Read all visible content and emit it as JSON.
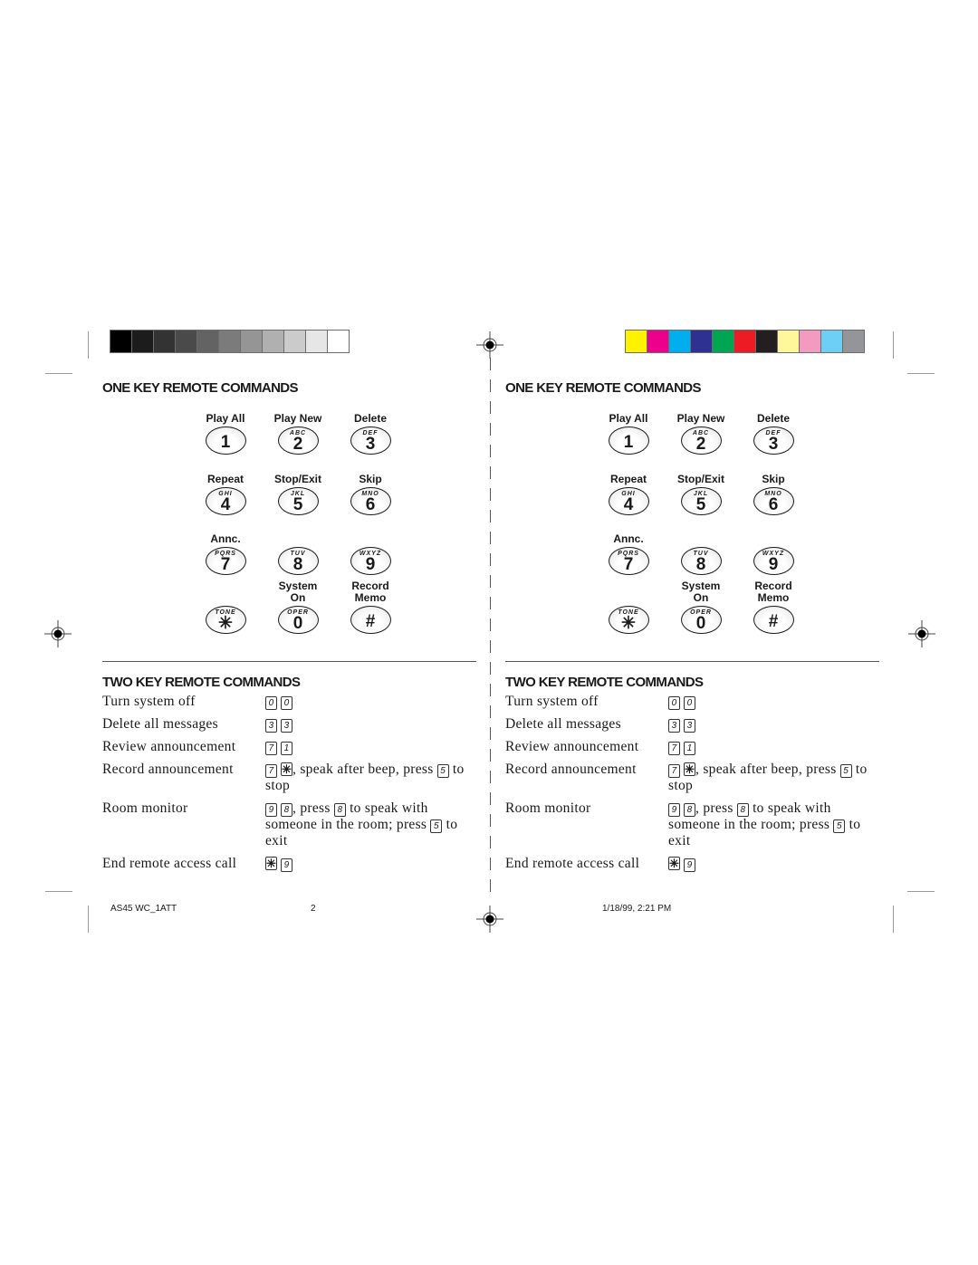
{
  "swatches": {
    "grayscale": [
      "#000000",
      "#1c1c1c",
      "#333333",
      "#4a4a4a",
      "#636363",
      "#7b7b7b",
      "#959595",
      "#b0b0b0",
      "#cbcbcb",
      "#e6e6e6",
      "#ffffff"
    ],
    "color": [
      "#fff200",
      "#ec008c",
      "#00aeef",
      "#2e3192",
      "#00a651",
      "#ed1c24",
      "#231f20",
      "#fff799",
      "#f49ac1",
      "#6dcff6",
      "#939598"
    ]
  },
  "panels": [
    {
      "one_key": {
        "title": "ONE KEY REMOTE COMMANDS",
        "keys": [
          {
            "label": "Play All",
            "letters": "",
            "digit": "1"
          },
          {
            "label": "Play New",
            "letters": "ABC",
            "digit": "2"
          },
          {
            "label": "Delete",
            "letters": "DEF",
            "digit": "3"
          },
          {
            "label": "Repeat",
            "letters": "GHI",
            "digit": "4"
          },
          {
            "label": "Stop/Exit",
            "letters": "JKL",
            "digit": "5"
          },
          {
            "label": "Skip",
            "letters": "MNO",
            "digit": "6"
          },
          {
            "label": "Annc.",
            "letters": "PQRS",
            "digit": "7"
          },
          {
            "label": "",
            "letters": "TUV",
            "digit": "8"
          },
          {
            "label": "",
            "letters": "WXYZ",
            "digit": "9"
          },
          {
            "label": "",
            "letters": "TONE",
            "digit": "✳"
          },
          {
            "label": "System On",
            "letters": "OPER",
            "digit": "0"
          },
          {
            "label": "Record Memo",
            "letters": "",
            "digit": "#"
          }
        ]
      },
      "two_key": {
        "title": "TWO KEY REMOTE COMMANDS",
        "commands": [
          {
            "name": "Turn system off",
            "parts": [
              {
                "k": "0"
              },
              {
                "k": "0"
              }
            ]
          },
          {
            "name": "Delete all messages",
            "parts": [
              {
                "k": "3"
              },
              {
                "k": "3"
              }
            ]
          },
          {
            "name": "Review announcement",
            "parts": [
              {
                "k": "7"
              },
              {
                "k": "1"
              }
            ]
          },
          {
            "name": "Record announcement",
            "parts": [
              {
                "k": "7"
              },
              {
                "k": "✳"
              },
              {
                "t": ", speak after beep, press "
              },
              {
                "k": "5"
              },
              {
                "t": " to stop"
              }
            ]
          },
          {
            "name": "Room monitor",
            "parts": [
              {
                "k": "9"
              },
              {
                "k": "8"
              },
              {
                "t": ", press "
              },
              {
                "k": "8"
              },
              {
                "t": " to speak with someone in the room; press "
              },
              {
                "k": "5"
              },
              {
                "t": " to exit"
              }
            ]
          },
          {
            "name": "End remote access call",
            "parts": [
              {
                "k": "✳"
              },
              {
                "k": "9"
              }
            ]
          }
        ]
      }
    },
    {
      "one_key": {
        "title": "ONE KEY REMOTE COMMANDS",
        "keys": [
          {
            "label": "Play All",
            "letters": "",
            "digit": "1"
          },
          {
            "label": "Play New",
            "letters": "ABC",
            "digit": "2"
          },
          {
            "label": "Delete",
            "letters": "DEF",
            "digit": "3"
          },
          {
            "label": "Repeat",
            "letters": "GHI",
            "digit": "4"
          },
          {
            "label": "Stop/Exit",
            "letters": "JKL",
            "digit": "5"
          },
          {
            "label": "Skip",
            "letters": "MNO",
            "digit": "6"
          },
          {
            "label": "Annc.",
            "letters": "PQRS",
            "digit": "7"
          },
          {
            "label": "",
            "letters": "TUV",
            "digit": "8"
          },
          {
            "label": "",
            "letters": "WXYZ",
            "digit": "9"
          },
          {
            "label": "",
            "letters": "TONE",
            "digit": "✳"
          },
          {
            "label": "System On",
            "letters": "OPER",
            "digit": "0"
          },
          {
            "label": "Record Memo",
            "letters": "",
            "digit": "#"
          }
        ]
      },
      "two_key": {
        "title": "TWO KEY REMOTE COMMANDS",
        "commands": [
          {
            "name": "Turn system off",
            "parts": [
              {
                "k": "0"
              },
              {
                "k": "0"
              }
            ]
          },
          {
            "name": "Delete all messages",
            "parts": [
              {
                "k": "3"
              },
              {
                "k": "3"
              }
            ]
          },
          {
            "name": "Review announcement",
            "parts": [
              {
                "k": "7"
              },
              {
                "k": "1"
              }
            ]
          },
          {
            "name": "Record announcement",
            "parts": [
              {
                "k": "7"
              },
              {
                "k": "✳"
              },
              {
                "t": ", speak after beep, press "
              },
              {
                "k": "5"
              },
              {
                "t": " to stop"
              }
            ]
          },
          {
            "name": "Room monitor",
            "parts": [
              {
                "k": "9"
              },
              {
                "k": "8"
              },
              {
                "t": ", press "
              },
              {
                "k": "8"
              },
              {
                "t": " to speak with someone in the room; press "
              },
              {
                "k": "5"
              },
              {
                "t": " to exit"
              }
            ]
          },
          {
            "name": "End remote access call",
            "parts": [
              {
                "k": "✳"
              },
              {
                "k": "9"
              }
            ]
          }
        ]
      }
    }
  ],
  "footer": {
    "file_name": "AS45 WC_1ATT",
    "page_number": "2",
    "timestamp": "1/18/99, 2:21 PM"
  },
  "icons": {
    "registration_mark": "registration-target-icon",
    "crop_mark": "crop-mark"
  }
}
